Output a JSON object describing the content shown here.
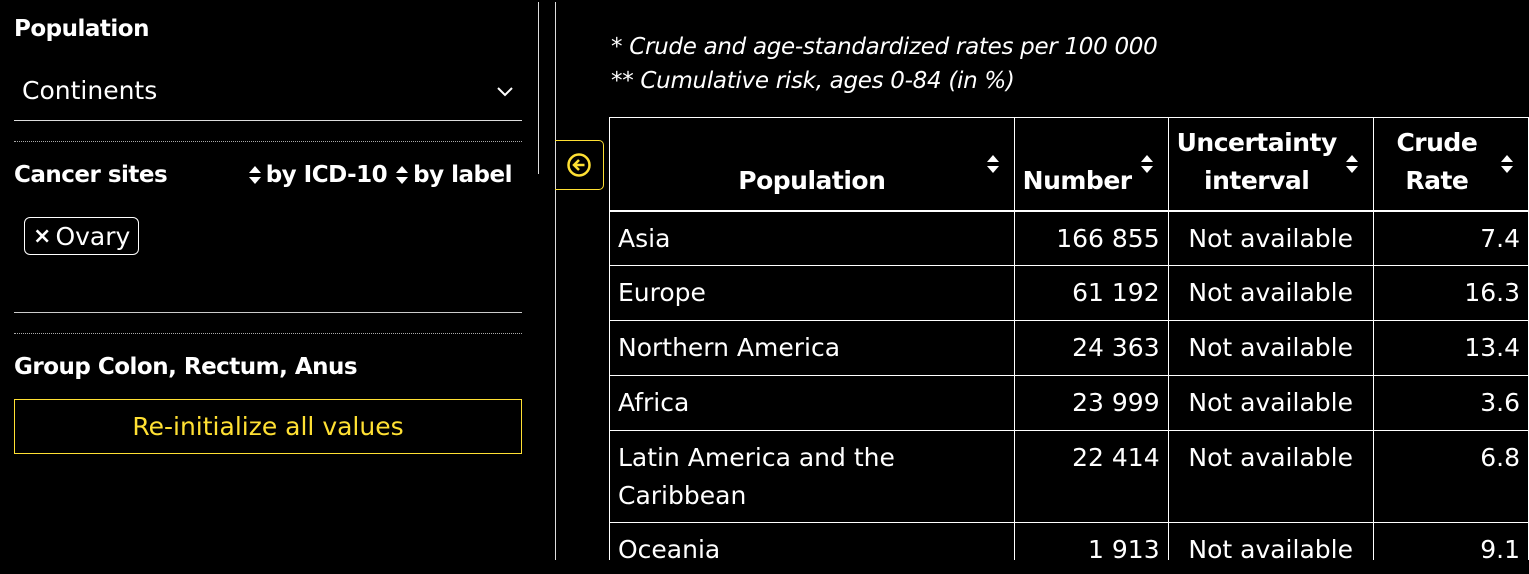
{
  "filters": {
    "population_title": "Population",
    "population_value": "Continents",
    "cancer_sites_title": "Cancer sites",
    "sort_by_icd": "by ICD-10",
    "sort_by_label": "by label",
    "selected_tag": "Ovary",
    "tag_remove": "×",
    "group_title": "Group Colon, Rectum, Anus",
    "reinit_label": "Re-initialize all values"
  },
  "notes": {
    "line1": "* Crude and age-standardized rates per 100 000",
    "line2": "** Cumulative risk, ages 0-84 (in %)"
  },
  "table": {
    "headers": {
      "population": "Population",
      "number": "Number",
      "uncertainty_line1": "Uncertainty",
      "uncertainty_line2": "interval",
      "crude_line1": "Crude",
      "crude_line2": "Rate"
    },
    "rows": [
      {
        "population": "Asia",
        "number": "166 855",
        "uncertainty": "Not available",
        "crude_rate": "7.4"
      },
      {
        "population": "Europe",
        "number": "61 192",
        "uncertainty": "Not available",
        "crude_rate": "16.3"
      },
      {
        "population": "Northern America",
        "number": "24 363",
        "uncertainty": "Not available",
        "crude_rate": "13.4"
      },
      {
        "population": "Africa",
        "number": "23 999",
        "uncertainty": "Not available",
        "crude_rate": "3.6"
      },
      {
        "population": "Latin America and the Caribbean",
        "number": "22 414",
        "uncertainty": "Not available",
        "crude_rate": "6.8"
      },
      {
        "population": "Oceania",
        "number": "1 913",
        "uncertainty": "Not available",
        "crude_rate": "9.1"
      }
    ]
  },
  "colors": {
    "background": "#000000",
    "text": "#ffffff",
    "accent": "#ffe033"
  }
}
